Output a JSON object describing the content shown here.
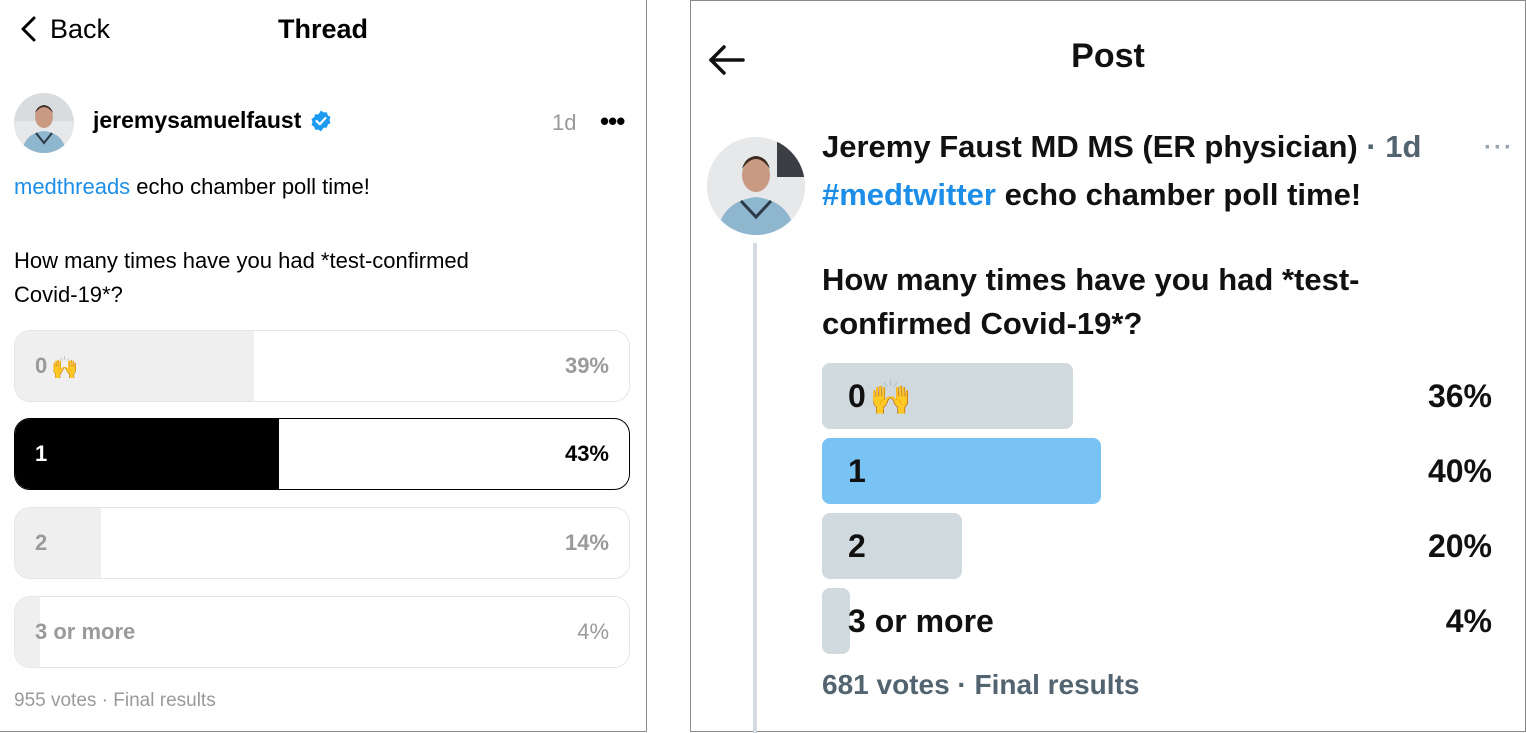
{
  "threads": {
    "back_label": "Back",
    "title": "Thread",
    "username": "jeremysamuelfaust",
    "time": "1d",
    "more": "•••",
    "tag": "medthreads",
    "line1_rest": " echo chamber poll time!",
    "question_line1": "How many times have you had *test-confirmed",
    "question_line2": "Covid-19*?",
    "options": [
      {
        "label": "0",
        "emoji": "🙌",
        "percent_text": "39%",
        "percent": 39,
        "selected": false
      },
      {
        "label": "1",
        "emoji": "",
        "percent_text": "43%",
        "percent": 43,
        "selected": true
      },
      {
        "label": "2",
        "emoji": "",
        "percent_text": "14%",
        "percent": 14,
        "selected": false
      },
      {
        "label": "3 or more",
        "emoji": "",
        "percent_text": "4%",
        "percent": 4,
        "selected": false
      }
    ],
    "footer": "955 votes · Final results",
    "colors": {
      "link": "#1d8ee8",
      "verified": "#1d9bf0",
      "selected_fill": "#000000",
      "bar_fill": "#efefef"
    }
  },
  "x": {
    "title": "Post",
    "display_name": "Jeremy Faust MD MS (ER physician)",
    "time_sep": " · 1d",
    "more": "···",
    "hashtag": "#medtwitter",
    "line1_rest": " echo chamber poll time!",
    "question_line1": "How many times have you had *test-",
    "question_line2": "confirmed Covid-19*?",
    "options": [
      {
        "label": "0",
        "emoji": "🙌",
        "percent_text": "36%",
        "percent": 36,
        "winner": false
      },
      {
        "label": "1",
        "emoji": "",
        "percent_text": "40%",
        "percent": 40,
        "winner": true
      },
      {
        "label": "2",
        "emoji": "",
        "percent_text": "20%",
        "percent": 20,
        "winner": false
      },
      {
        "label": "3 or more",
        "emoji": "",
        "percent_text": "4%",
        "percent": 4,
        "winner": false
      }
    ],
    "footer": "681 votes · Final results",
    "colors": {
      "link": "#1d8ee8",
      "winner_fill": "#79c2f4",
      "bar_fill": "#cfd9de"
    }
  }
}
